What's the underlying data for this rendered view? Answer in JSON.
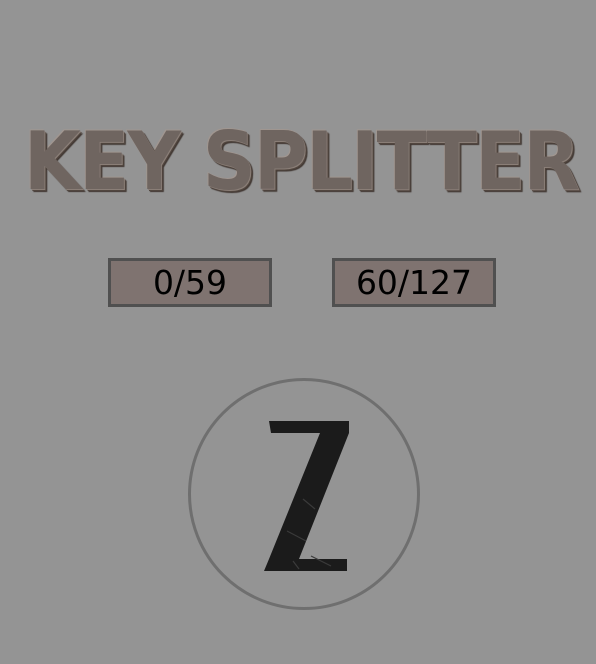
{
  "app": {
    "title": "KEY SPLITTER"
  },
  "ranges": {
    "low": "0/59",
    "high": "60/127"
  },
  "logo": {
    "icon": "z-logo-icon",
    "letter": "Z"
  },
  "colors": {
    "background": "#949494",
    "title": "#6f6560",
    "range_box_fill": "#7f7370",
    "range_box_border": "#505050",
    "knob_ring": "#6f6f6f",
    "logo": "#1b1b1b"
  }
}
